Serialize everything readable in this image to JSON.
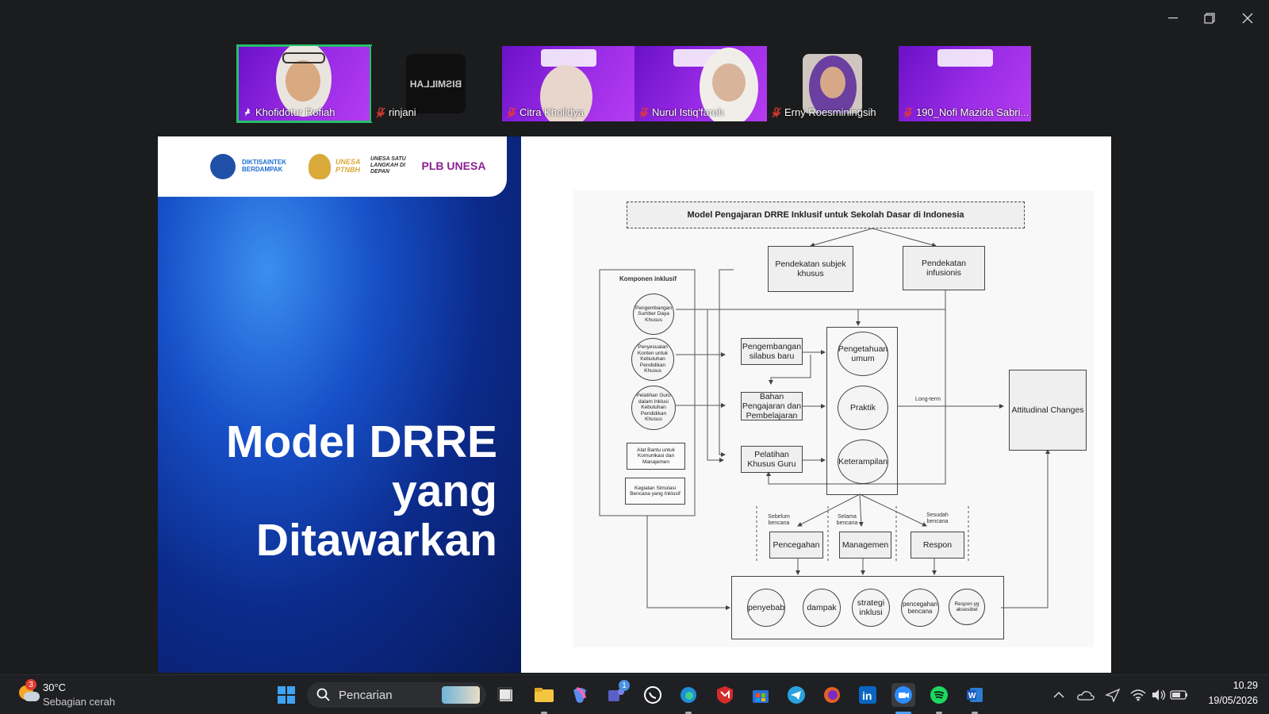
{
  "participants": [
    {
      "name": "Khofidotur Rofiah",
      "muted": false
    },
    {
      "name": "rinjani",
      "muted": true,
      "avatar_text": "BISMILLAH"
    },
    {
      "name": "Citra Kholidya",
      "muted": true
    },
    {
      "name": "Nurul Istiq'faroh",
      "muted": true
    },
    {
      "name": "Erny Roesminingsih",
      "muted": true
    },
    {
      "name": "190_Nofi Mazida Sabri...",
      "muted": true
    }
  ],
  "slide": {
    "title_lines": [
      "Model DRRE",
      "yang",
      "Ditawarkan"
    ],
    "logos": [
      "DIKTISAINTEK BERDAMPAK",
      "UNESA PTNBH",
      "UNESA SATU LANGKAH DI DEPAN",
      "PLB UNESA"
    ]
  },
  "diagram": {
    "title": "Model Pengajaran DRRE Inklusif untuk Sekolah Dasar di Indonesia",
    "approach_subject": "Pendekatan subjek khusus",
    "approach_infusion": "Pendekatan infusionis",
    "component_header": "Komponen inklusif",
    "components": [
      "Pengembangan Sumber Daya Khusus",
      "Penyesuaian Konten untuk Kebutuhan Pendidikan Khusus",
      "Pelatihan Guru dalam Inklusi Kebutuhan Pendidikan Khusus",
      "Alat Bantu untuk Komunikasi dan Manajemen",
      "Kegiatan Simulasi Bencana yang Inklusif"
    ],
    "mid_boxes": [
      "Pengembangan silabus baru",
      "Bahan Pengajaran dan Pembelajaran",
      "Pelatihan Khusus Guru"
    ],
    "outcomes": [
      "Pengetahuan umum",
      "Praktik",
      "Keterampilan"
    ],
    "long_term": "Long-term",
    "result": "Attitudinal Changes",
    "phase_labels": [
      "Sebelum bencana",
      "Selama bencana",
      "Sesudah bencana"
    ],
    "phases": [
      "Pencegahan",
      "Managemen",
      "Respon"
    ],
    "bottom": [
      "penyebab",
      "dampak",
      "strategi inklusi",
      "pencegahan bencana",
      "Respon yg aksesibel"
    ]
  },
  "taskbar": {
    "weather_temp": "30°C",
    "weather_desc": "Sebagian cerah",
    "weather_badge": "3",
    "search_placeholder": "Pencarian",
    "teams_badge": "1",
    "time": "10.29",
    "date": "19/05/2026"
  },
  "colors": {
    "active_speaker": "#25c06b",
    "tile_purple": "#8a22de",
    "slide_blue": "#0b2a8a"
  }
}
